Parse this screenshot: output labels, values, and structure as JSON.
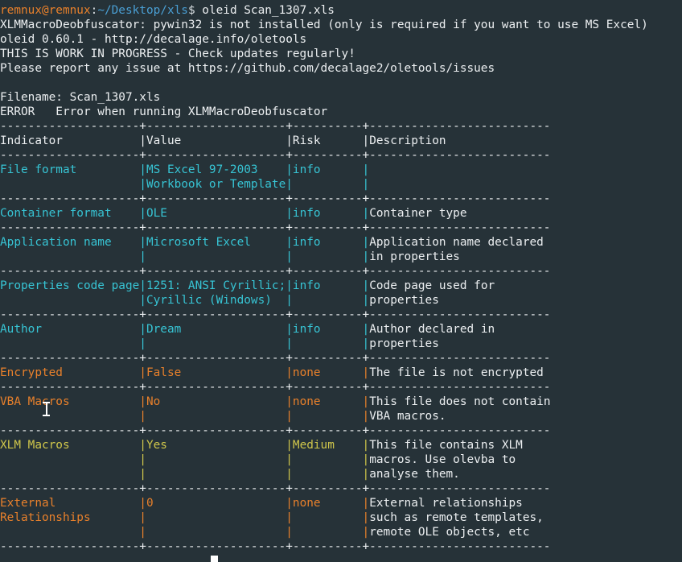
{
  "terminal": {
    "colors": {
      "background": "#263238",
      "foreground": "#eceff1",
      "orange": "#e8802b",
      "blue": "#4a9fd4",
      "cyan": "#37c4d4",
      "yellow": "#cfc64b",
      "white": "#ffffff"
    },
    "prompt": {
      "user_host": "remnux@remnux",
      "separator": ":",
      "path": "~/Desktop/xls",
      "sigil": "$",
      "command": " oleid Scan_1307.xls"
    },
    "banner": [
      "XLMMacroDeobfuscator: pywin32 is not installed (only is required if you want to use MS Excel)",
      "oleid 0.60.1 - http://decalage.info/oletools",
      "THIS IS WORK IN PROGRESS - Check updates regularly!",
      "Please report any issue at https://github.com/decalage2/oletools/issues"
    ],
    "filename_line": "Filename: Scan_1307.xls",
    "error_line": "ERROR   Error when running XLMMacroDeobfuscator",
    "separator_line": "--------------------+--------------------+----------+--------------------------",
    "table": {
      "headers": {
        "indicator": "Indicator",
        "value": "Value",
        "risk": "Risk",
        "description": "Description"
      },
      "rows": [
        {
          "color": "cyan",
          "indicator": [
            "File format"
          ],
          "value": [
            "MS Excel 97-2003",
            "Workbook or Template"
          ],
          "risk": [
            "info"
          ],
          "description": [
            "",
            ""
          ]
        },
        {
          "color": "cyan",
          "indicator": [
            "Container format"
          ],
          "value": [
            "OLE"
          ],
          "risk": [
            "info"
          ],
          "description": [
            "Container type"
          ]
        },
        {
          "color": "cyan",
          "indicator": [
            "Application name"
          ],
          "value": [
            "Microsoft Excel"
          ],
          "risk": [
            "info"
          ],
          "description": [
            "Application name declared",
            "in properties"
          ]
        },
        {
          "color": "cyan",
          "indicator": [
            "Properties code page"
          ],
          "value": [
            "1251: ANSI Cyrillic;",
            "Cyrillic (Windows)"
          ],
          "risk": [
            "info"
          ],
          "description": [
            "Code page used for",
            "properties"
          ]
        },
        {
          "color": "cyan",
          "indicator": [
            "Author"
          ],
          "value": [
            "Dream"
          ],
          "risk": [
            "info"
          ],
          "description": [
            "Author declared in",
            "properties"
          ]
        },
        {
          "color": "orange",
          "indicator": [
            "Encrypted"
          ],
          "value": [
            "False"
          ],
          "risk": [
            "none"
          ],
          "description": [
            "The file is not encrypted"
          ]
        },
        {
          "color": "orange",
          "indicator": [
            "VBA Macros"
          ],
          "value": [
            "No"
          ],
          "risk": [
            "none"
          ],
          "description": [
            "This file does not contain",
            "VBA macros."
          ]
        },
        {
          "color": "yellow",
          "indicator": [
            "XLM Macros"
          ],
          "value": [
            "Yes"
          ],
          "risk": [
            "Medium"
          ],
          "description": [
            "This file contains XLM",
            "macros. Use olevba to",
            "analyse them."
          ]
        },
        {
          "color": "orange",
          "indicator": [
            "External",
            "Relationships"
          ],
          "value": [
            "0"
          ],
          "risk": [
            "none"
          ],
          "description": [
            "External relationships",
            "such as remote templates,",
            "remote OLE objects, etc"
          ]
        }
      ]
    },
    "cursor": {
      "mouse_shape": "i-beam",
      "text_cursor_shape": "block"
    }
  }
}
